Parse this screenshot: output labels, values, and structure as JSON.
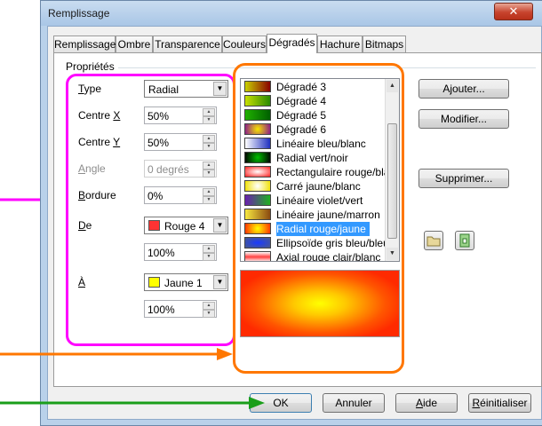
{
  "window": {
    "title": "Remplissage",
    "close_symbol": "✕"
  },
  "tabs": [
    {
      "label": "Remplissage"
    },
    {
      "label": "Ombre"
    },
    {
      "label": "Transparence"
    },
    {
      "label": "Couleurs"
    },
    {
      "label": "Dégradés",
      "active": true
    },
    {
      "label": "Hachure"
    },
    {
      "label": "Bitmaps"
    }
  ],
  "group": {
    "title": "Propriétés"
  },
  "fields": {
    "type_label": "Type",
    "type_value": "Radial",
    "centre_x_label": "Centre X",
    "centre_x_value": "50%",
    "centre_y_label": "Centre Y",
    "centre_y_value": "50%",
    "angle_label": "Angle",
    "angle_value": "0 degrés",
    "bordure_label": "Bordure",
    "bordure_value": "0%",
    "de_label": "De",
    "de_color": "Rouge 4",
    "de_color_hex": "#ff3333",
    "de_percent": "100%",
    "a_label": "À",
    "a_color": "Jaune 1",
    "a_color_hex": "#ffff00",
    "a_percent": "100%"
  },
  "gradients": [
    {
      "name": "Dégradé 3"
    },
    {
      "name": "Dégradé 4"
    },
    {
      "name": "Dégradé 5"
    },
    {
      "name": "Dégradé 6"
    },
    {
      "name": "Linéaire bleu/blanc"
    },
    {
      "name": "Radial vert/noir"
    },
    {
      "name": "Rectangulaire rouge/blanc"
    },
    {
      "name": "Carré jaune/blanc"
    },
    {
      "name": "Linéaire violet/vert"
    },
    {
      "name": "Linéaire jaune/marron"
    },
    {
      "name": "Radial rouge/jaune",
      "selected": true
    },
    {
      "name": "Ellipsoïde gris bleu/bleu"
    },
    {
      "name": "Axial rouge clair/blanc"
    }
  ],
  "side_buttons": {
    "add": "Ajouter...",
    "modify": "Modifier...",
    "delete": "Supprimer..."
  },
  "footer": {
    "ok": "OK",
    "cancel": "Annuler",
    "help": "Aide",
    "reset": "Réinitialiser"
  },
  "annotation_colors": {
    "magenta": "#ff00ff",
    "orange": "#ff7700",
    "green": "#1a9e1a"
  }
}
